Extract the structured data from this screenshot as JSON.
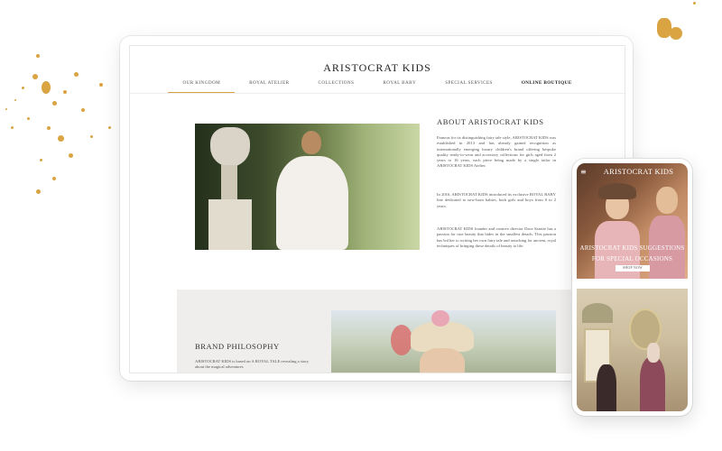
{
  "tablet": {
    "brand": "ARISTOCRAT KIDS",
    "nav": [
      {
        "label": "OUR KINGDOM",
        "active": true
      },
      {
        "label": "ROYAL ATELIER"
      },
      {
        "label": "COLLECTIONS"
      },
      {
        "label": "ROYAL BABY"
      },
      {
        "label": "SPECIAL SERVICES"
      },
      {
        "label": "ONLINE BOUTIQUE"
      }
    ],
    "about": {
      "title": "ABOUT ARISTOCRAT KIDS",
      "p1": "Famous for its distinguishing fairy tale style, ARISTOCRAT KIDS was established in 2013 and has already gained recognition as internationally emerging luxury children's brand offering bespoke quality ready-to-wear and accessory collections for girls aged from 2 years to 16 years, each piece being made by a single tailor in ARISTOCRAT KIDS Atelier.",
      "p2": "In 2016, ARISTOCRAT KIDS introduced its exclusive ROYAL BABY line dedicated to new-born babies, both girls and boys from 0 to 2 years.",
      "p3": "ARISTOCRAT KIDS founder and creative director Dace Sarnite has a passion for true beauty that hides in the smallest details. This passion has led her to writing her own fairy tale and searching for ancient, royal techniques of bringing these details of beauty to life."
    },
    "philosophy": {
      "title": "BRAND PHILOSOPHY",
      "text": "ARISTOCRAT KIDS is based on A ROYAL TALE revealing a story about the magical adventures"
    }
  },
  "phone": {
    "menu_icon": "≡",
    "brand": "ARISTOCRAT KIDS",
    "caption_line1": "ARISTOCRAT KIDS SUGGESTIONS",
    "caption_line2": "FOR SPECIAL OCCASIONS",
    "button": "SHOP NOW"
  },
  "colors": {
    "accent": "#d9a441",
    "band": "#efeeec"
  }
}
